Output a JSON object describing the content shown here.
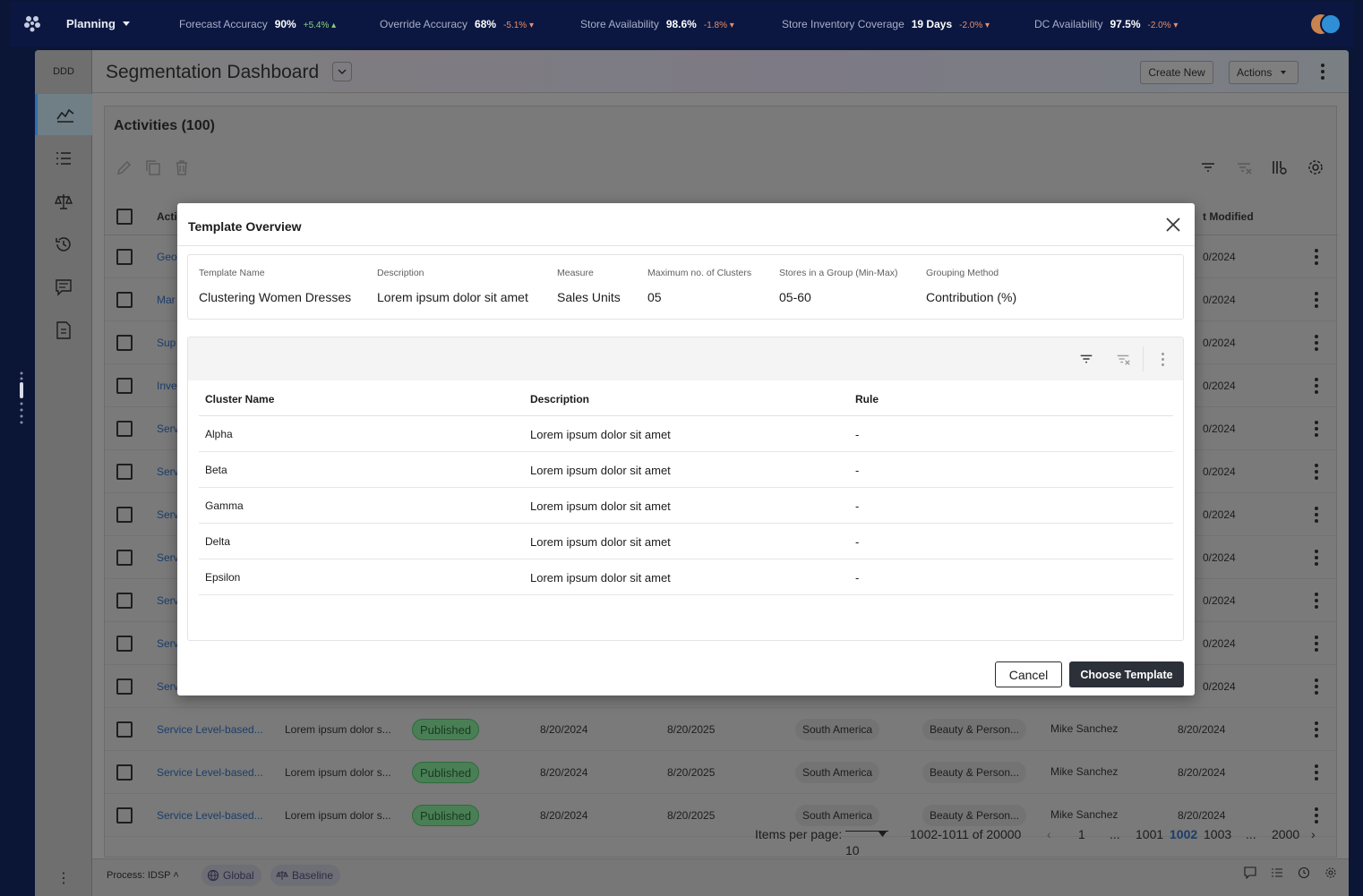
{
  "topbar": {
    "app_menu": "Planning",
    "kpis": [
      {
        "label": "Forecast Accuracy",
        "value": "90%",
        "delta": "+5.4%",
        "dir": "up"
      },
      {
        "label": "Override Accuracy",
        "value": "68%",
        "delta": "-5.1%",
        "dir": "down"
      },
      {
        "label": "Store Availability",
        "value": "98.6%",
        "delta": "-1.8%",
        "dir": "down"
      },
      {
        "label": "Store Inventory Coverage",
        "value": "19 Days",
        "delta": "-2.0%",
        "dir": "down"
      },
      {
        "label": "DC Availability",
        "value": "97.5%",
        "delta": "-2.0%",
        "dir": "down"
      }
    ]
  },
  "sidebar": {
    "brand": "DDD",
    "items": [
      "trend-chart-icon",
      "list-icon",
      "balance-scale-icon",
      "history-icon",
      "comment-icon",
      "document-icon"
    ]
  },
  "header": {
    "title": "Segmentation Dashboard",
    "create_new": "Create New",
    "actions": "Actions"
  },
  "panel": {
    "title": "Activities (100)",
    "col_first": "Acti",
    "col_last": "t Modified",
    "partial_rows": [
      {
        "name": "Geo",
        "date": "0/2024"
      },
      {
        "name": "Mar",
        "date": "0/2024"
      },
      {
        "name": "Sup",
        "date": "0/2024"
      },
      {
        "name": "Inve",
        "date": "0/2024"
      },
      {
        "name": "Serv",
        "date": "0/2024"
      },
      {
        "name": "Serv",
        "date": "0/2024"
      },
      {
        "name": "Serv",
        "date": "0/2024"
      },
      {
        "name": "Serv",
        "date": "0/2024"
      },
      {
        "name": "Serv",
        "date": "0/2024"
      },
      {
        "name": "Serv",
        "date": "0/2024"
      },
      {
        "name": "Serv",
        "date": "0/2024"
      }
    ],
    "full_rows": [
      {
        "name": "Service Level-based...",
        "desc": "Lorem ipsum dolor s...",
        "status": "Published",
        "start": "8/20/2024",
        "end": "8/20/2025",
        "region": "South America",
        "category": "Beauty & Person...",
        "owner": "Mike Sanchez",
        "modified": "8/20/2024"
      },
      {
        "name": "Service Level-based...",
        "desc": "Lorem ipsum dolor s...",
        "status": "Published",
        "start": "8/20/2024",
        "end": "8/20/2025",
        "region": "South America",
        "category": "Beauty & Person...",
        "owner": "Mike Sanchez",
        "modified": "8/20/2024"
      },
      {
        "name": "Service Level-based...",
        "desc": "Lorem ipsum dolor s...",
        "status": "Published",
        "start": "8/20/2024",
        "end": "8/20/2025",
        "region": "South America",
        "category": "Beauty & Person...",
        "owner": "Mike Sanchez",
        "modified": "8/20/2024"
      }
    ]
  },
  "pager": {
    "items_per_page_label": "Items per page:",
    "items_per_page_value": "10",
    "range": "1002-1011 of 20000",
    "first": "1",
    "ellipsis1": "...",
    "p1": "1001",
    "p2": "1002",
    "p3": "1003",
    "ellipsis2": "...",
    "last": "2000"
  },
  "footer": {
    "process": "Process: IDSP",
    "chip1": "Global",
    "chip2": "Baseline"
  },
  "modal": {
    "title": "Template Overview",
    "summary": [
      {
        "label": "Template Name",
        "value": "Clustering Women Dresses"
      },
      {
        "label": "Description",
        "value": "Lorem ipsum dolor sit amet"
      },
      {
        "label": "Measure",
        "value": "Sales Units"
      },
      {
        "label": "Maximum no. of Clusters",
        "value": "05"
      },
      {
        "label": "Stores in a Group (Min-Max)",
        "value": "05-60"
      },
      {
        "label": "Grouping Method",
        "value": "Contribution (%)"
      }
    ],
    "columns": [
      "Cluster Name",
      "Description",
      "Rule"
    ],
    "rows": [
      {
        "name": "Alpha",
        "desc": "Lorem ipsum dolor sit amet",
        "rule": "-"
      },
      {
        "name": "Beta",
        "desc": "Lorem ipsum dolor sit amet",
        "rule": "-"
      },
      {
        "name": "Gamma",
        "desc": "Lorem ipsum dolor sit amet",
        "rule": "-"
      },
      {
        "name": "Delta",
        "desc": "Lorem ipsum dolor sit amet",
        "rule": "-"
      },
      {
        "name": "Epsilon",
        "desc": "Lorem ipsum dolor sit amet",
        "rule": "-"
      }
    ],
    "cancel": "Cancel",
    "choose": "Choose Template"
  },
  "colors": {
    "topbar_bg": "#0b1740",
    "primary_dark": "#2c3038",
    "link_blue": "#1b6fb5",
    "published_green": "#4a7f55"
  }
}
